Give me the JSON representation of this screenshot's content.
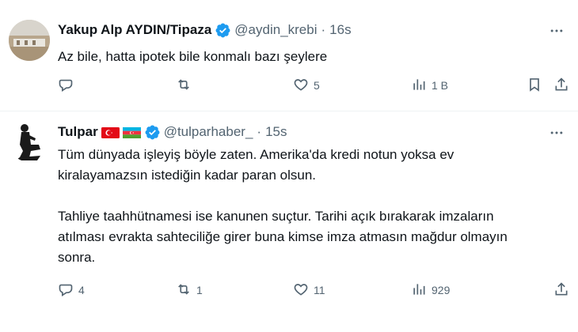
{
  "tweets": [
    {
      "author": "Yakup Alp AYDIN/Tipaza",
      "handle": "@aydin_krebi",
      "dot": "·",
      "time": "16s",
      "text": "Az bile, hatta ipotek bile konmalı bazı şeylere",
      "replies": "",
      "reposts": "",
      "likes": "5",
      "views": "1 B"
    },
    {
      "author": "Tulpar",
      "handle": "@tulparhaber_",
      "dot": "·",
      "time": "15s",
      "text": "Tüm dünyada işleyiş böyle zaten. Amerika'da kredi notun yoksa ev\nkiralayamazsın istediğin kadar paran olsun.\n\nTahliye taahhütnamesi ise kanunen suçtur. Tarihi açık bırakarak imzaların\natılması evrakta sahteciliğe girer buna kimse imza atmasın mağdur olmayın\nsonra.",
      "replies": "4",
      "reposts": "1",
      "likes": "11",
      "views": "929"
    }
  ],
  "colors": {
    "accent": "#1d9bf0",
    "muted": "#536471",
    "text": "#0f1419",
    "divider": "#eff3f4"
  },
  "icons": {
    "verified": "verified-badge-icon",
    "more": "more-options-icon",
    "reply": "reply-icon",
    "repost": "repost-icon",
    "like": "heart-icon",
    "views": "views-chart-icon",
    "bookmark": "bookmark-icon",
    "share": "share-icon",
    "flags": [
      "turkey-flag-icon",
      "azerbaijan-flag-icon"
    ]
  }
}
